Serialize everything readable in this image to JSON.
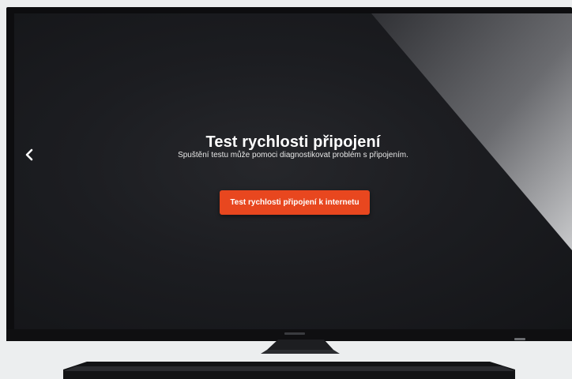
{
  "screen": {
    "back_icon": "chevron-left-icon",
    "title": "Test rychlosti připojení",
    "subtitle": "Spuštění testu může pomoci diagnostikovat problém s připojením.",
    "button_label": "Test rychlosti připojení k internetu"
  },
  "colors": {
    "accent": "#e8471f",
    "screen_background": "#1c1d21",
    "text": "#ffffff"
  }
}
